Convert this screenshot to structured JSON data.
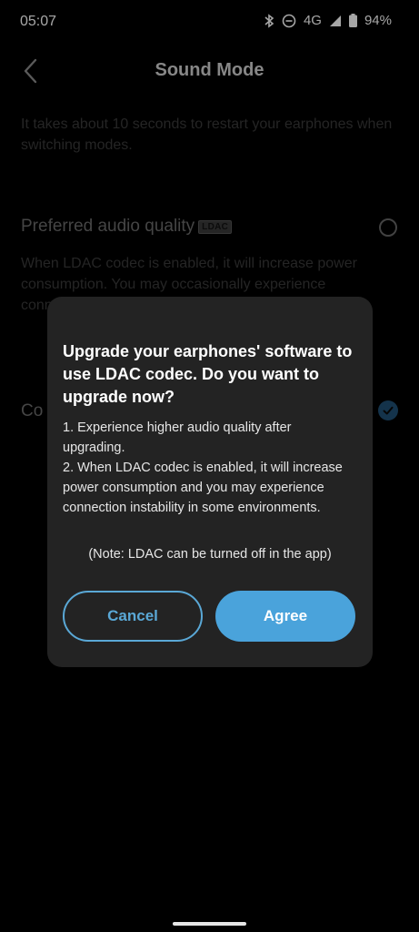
{
  "status_bar": {
    "time": "05:07",
    "network": "4G",
    "battery": "94%"
  },
  "header": {
    "title": "Sound Mode"
  },
  "info_text": "It takes about 10 seconds to restart your earphones when switching modes.",
  "options": [
    {
      "title": "Preferred audio quality",
      "badge": "LDAC",
      "description": "When LDAC codec is enabled, it will increase power consumption. You may occasionally experience connection instability in some environments.",
      "selected": false
    },
    {
      "title": "Co",
      "selected": true
    }
  ],
  "dialog": {
    "title": "Upgrade your earphones' software to use LDAC codec. Do you want to upgrade now?",
    "point1": "1. Experience higher audio quality after upgrading.",
    "point2": "2. When LDAC codec is enabled, it will increase power consumption and you may experience connection instability in some environments.",
    "note": "(Note: LDAC can be turned off in the app)",
    "cancel_label": "Cancel",
    "agree_label": "Agree"
  },
  "colors": {
    "accent": "#4aa3db",
    "dialog_bg": "#232323"
  }
}
